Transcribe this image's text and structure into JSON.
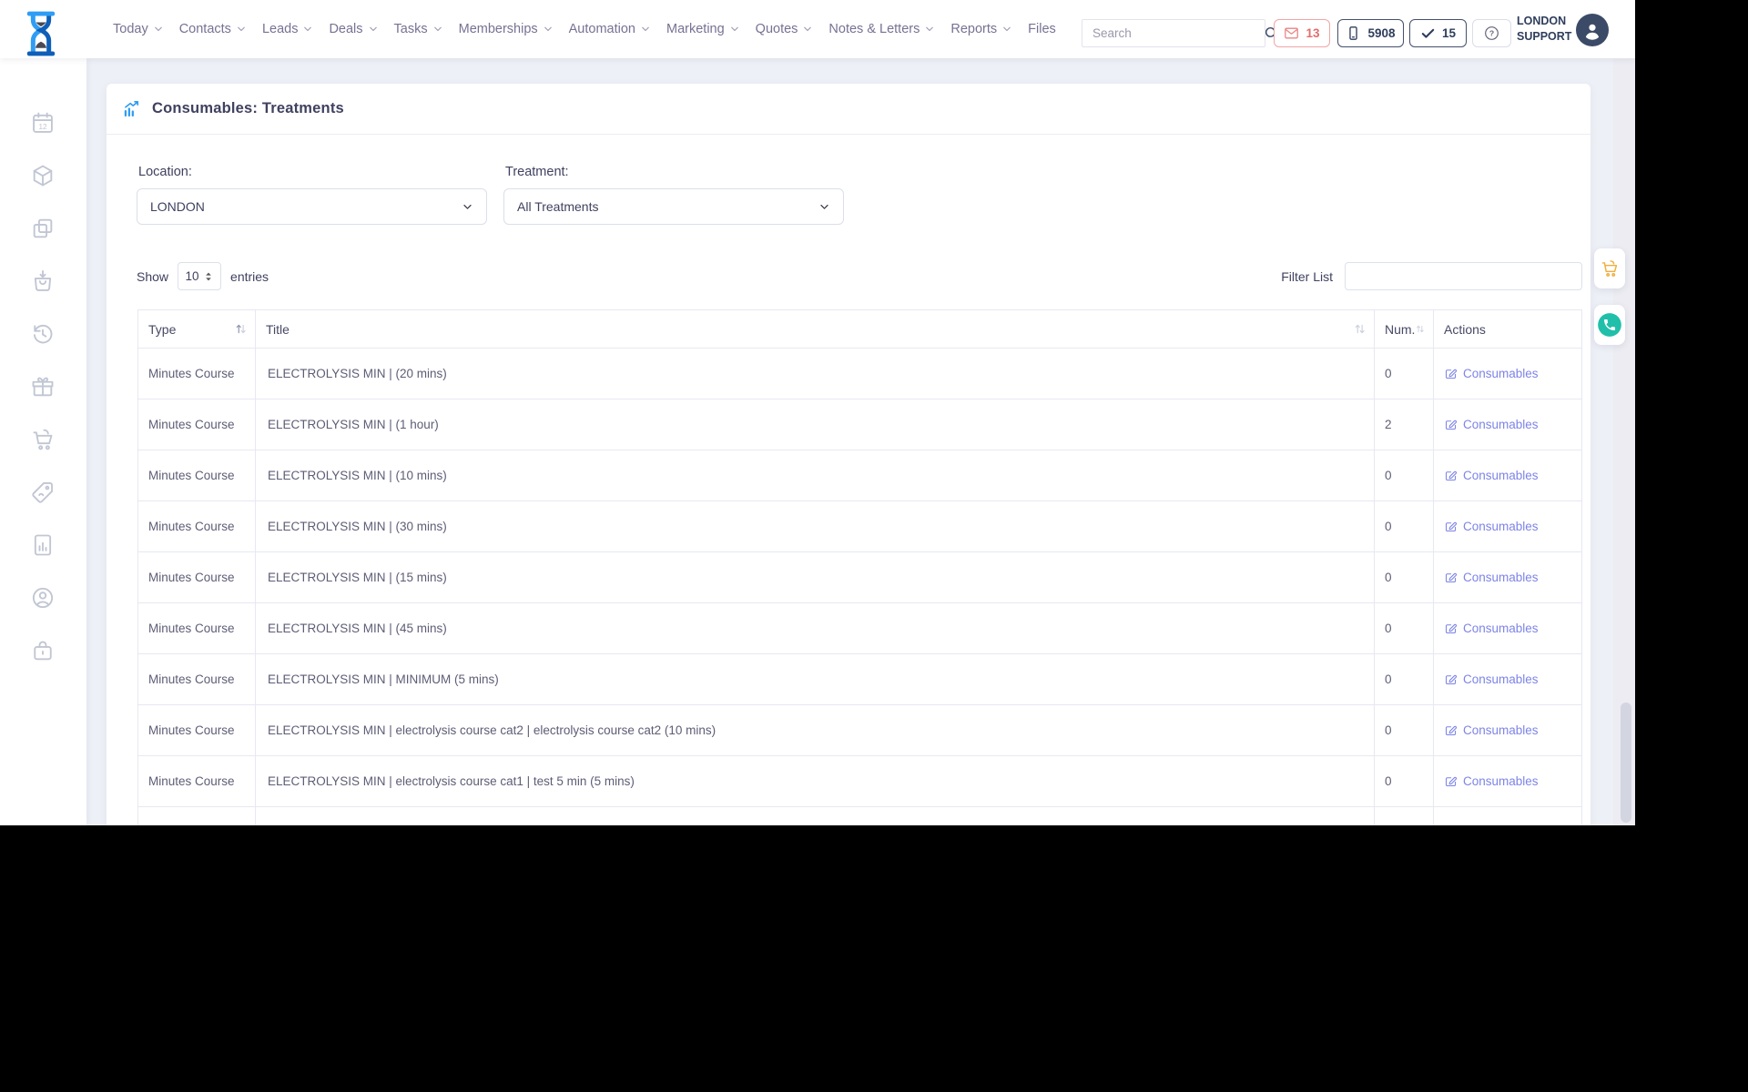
{
  "navbar": {
    "logo_icon": "hourglass-logo",
    "menu": [
      {
        "label": "Today",
        "dropdown": true
      },
      {
        "label": "Contacts",
        "dropdown": true
      },
      {
        "label": "Leads",
        "dropdown": true
      },
      {
        "label": "Deals",
        "dropdown": true
      },
      {
        "label": "Tasks",
        "dropdown": true
      },
      {
        "label": "Memberships",
        "dropdown": true
      },
      {
        "label": "Automation",
        "dropdown": true
      },
      {
        "label": "Marketing",
        "dropdown": true
      },
      {
        "label": "Quotes",
        "dropdown": true
      },
      {
        "label": "Notes & Letters",
        "dropdown": true
      },
      {
        "label": "Reports",
        "dropdown": true
      },
      {
        "label": "Files",
        "dropdown": false
      }
    ],
    "search": {
      "placeholder": "Search",
      "icon": "search-icon"
    },
    "badges": [
      {
        "icon": "mail-icon",
        "count": "13",
        "color": "#e36d6d"
      },
      {
        "icon": "mobile-icon",
        "count": "5908",
        "color": "#2f3e5c"
      },
      {
        "icon": "check-icon",
        "count": "15",
        "color": "#2f3e5c"
      }
    ],
    "help_icon": "question-icon",
    "user": {
      "line1": "LONDON",
      "line2": "SUPPORT",
      "avatar_icon": "user-avatar-icon"
    }
  },
  "sidebar": {
    "items": [
      {
        "icon": "calendar-icon"
      },
      {
        "icon": "cube-icon"
      },
      {
        "icon": "copy-icon"
      },
      {
        "icon": "bag-receive-icon"
      },
      {
        "icon": "history-icon"
      },
      {
        "icon": "gift-icon"
      },
      {
        "icon": "cart-icon"
      },
      {
        "icon": "price-tag-icon"
      },
      {
        "icon": "report-icon"
      },
      {
        "icon": "account-icon"
      },
      {
        "icon": "lock-icon"
      }
    ]
  },
  "page": {
    "title": "Consumables: Treatments",
    "title_icon": "chart-increase-icon",
    "filters": {
      "location_label": "Location:",
      "location_value": "LONDON",
      "treatment_label": "Treatment:",
      "treatment_value": "All Treatments"
    },
    "controls": {
      "show_label": "Show",
      "page_size": "10",
      "entries_label": "entries",
      "filter_label": "Filter List",
      "filter_value": ""
    },
    "table": {
      "columns": [
        "Type",
        "Title",
        "Num.",
        "Actions"
      ],
      "action_label": "Consumables",
      "action_icon": "edit-icon",
      "rows": [
        {
          "type": "Minutes Course",
          "title": "ELECTROLYSIS MIN | (20 mins)",
          "num": "0"
        },
        {
          "type": "Minutes Course",
          "title": "ELECTROLYSIS MIN | (1 hour)",
          "num": "2"
        },
        {
          "type": "Minutes Course",
          "title": "ELECTROLYSIS MIN | (10 mins)",
          "num": "0"
        },
        {
          "type": "Minutes Course",
          "title": "ELECTROLYSIS MIN | (30 mins)",
          "num": "0"
        },
        {
          "type": "Minutes Course",
          "title": "ELECTROLYSIS MIN | (15 mins)",
          "num": "0"
        },
        {
          "type": "Minutes Course",
          "title": "ELECTROLYSIS MIN | (45 mins)",
          "num": "0"
        },
        {
          "type": "Minutes Course",
          "title": "ELECTROLYSIS MIN | MINIMUM (5 mins)",
          "num": "0"
        },
        {
          "type": "Minutes Course",
          "title": "ELECTROLYSIS MIN | electrolysis course cat2 | electrolysis course cat2 (10 mins)",
          "num": "0"
        },
        {
          "type": "Minutes Course",
          "title": "ELECTROLYSIS MIN | electrolysis course cat1 | test 5 min (5 mins)",
          "num": "0"
        }
      ],
      "partial_last_row": true
    }
  },
  "floating_buttons": [
    {
      "icon": "cart-icon",
      "color": "#f2ae3c"
    },
    {
      "icon": "whatsapp-icon",
      "color": "#20bfa9"
    }
  ],
  "colors": {
    "accent_blue": "#2e9df2",
    "link_purple": "#7d84e6",
    "danger_red": "#e36d6d",
    "navy": "#2f3e5c",
    "page_bg": "#eef0f7"
  }
}
